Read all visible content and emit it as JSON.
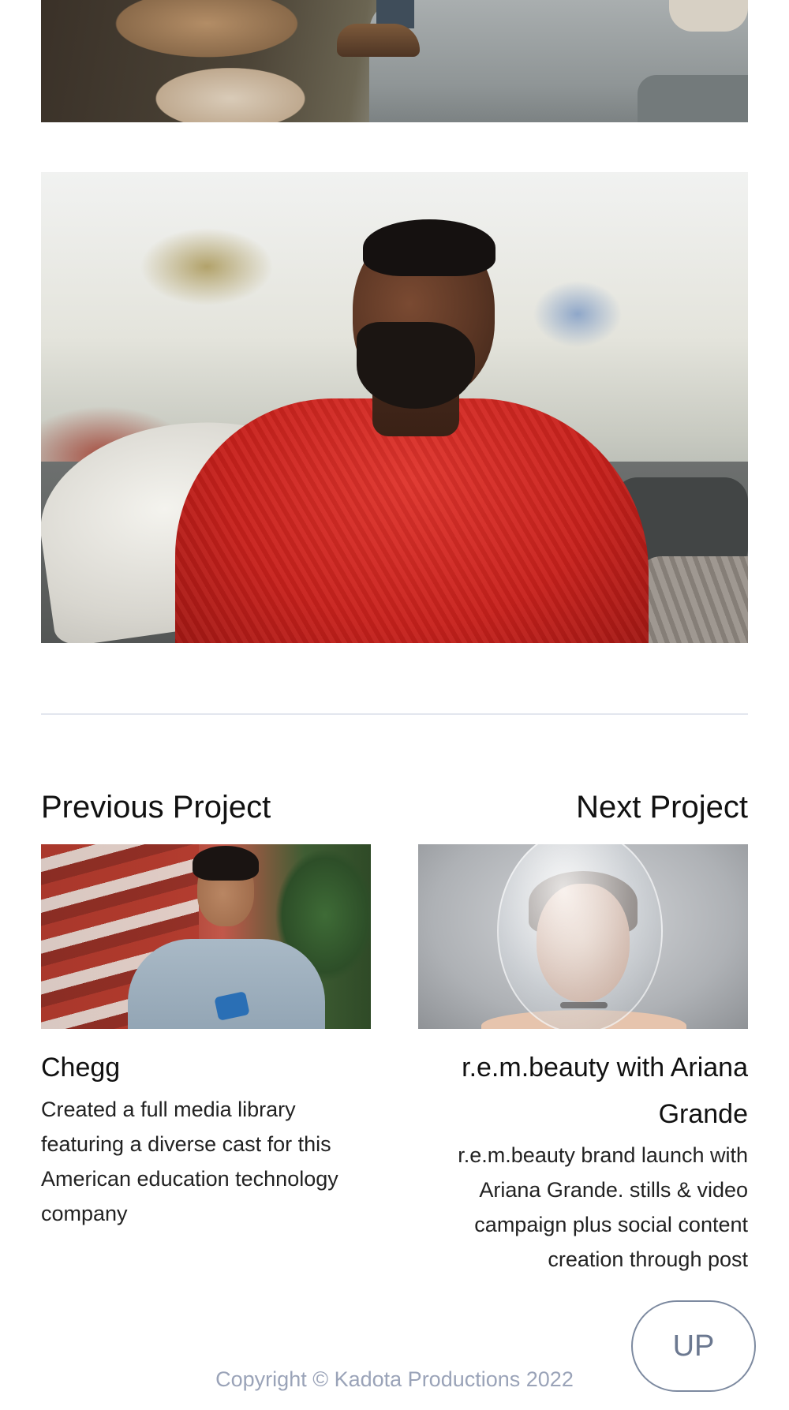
{
  "gallery": {
    "top_image_alt": "Cropped lifestyle photo with couch and coffee tables",
    "hero_image_alt": "Portrait of man in red knit sweater seated on sofa"
  },
  "project_nav": {
    "previous": {
      "heading": "Previous Project",
      "title": "Chegg",
      "description": "Created a full media library featuring a diverse cast for this American education technology company"
    },
    "next": {
      "heading": "Next Project",
      "title": "r.e.m.beauty with Ariana Grande",
      "description": "r.e.m.beauty brand launch with Ariana Grande. stills & video campaign plus social content creation through post"
    }
  },
  "up_button": {
    "label": "UP"
  },
  "footer": {
    "copyright": "Copyright © Kadota Productions 2022"
  },
  "colors": {
    "divider": "#e3e6ee",
    "up_button_border": "#7d8aa0",
    "copyright_text": "#9aa3b8"
  }
}
